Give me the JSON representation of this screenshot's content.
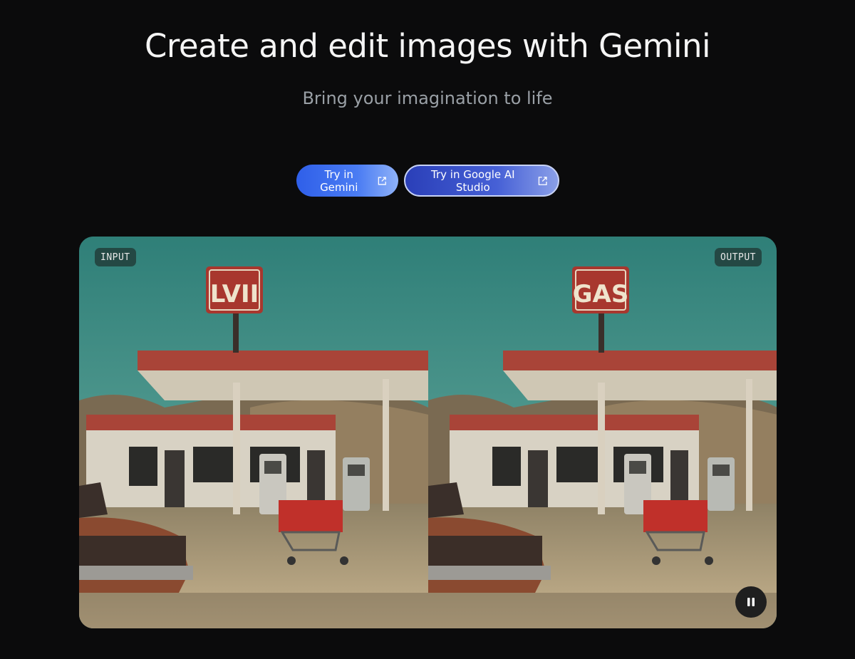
{
  "hero": {
    "title": "Create and edit images with Gemini",
    "subtitle": "Bring your imagination to life"
  },
  "cta": {
    "gemini_label": "Try in Gemini",
    "studio_label": "Try in Google AI Studio",
    "icon": "external-link-icon"
  },
  "comparison": {
    "input_tag": "INPUT",
    "output_tag": "OUTPUT",
    "input_sign_text": "LVII",
    "output_sign_text": "GAS",
    "control_icon": "pause-icon"
  },
  "colors": {
    "background": "#0b0b0c",
    "sky": "#3d8a82",
    "sign_red": "#a8372e",
    "accent_blue": "#3b6cf0"
  }
}
